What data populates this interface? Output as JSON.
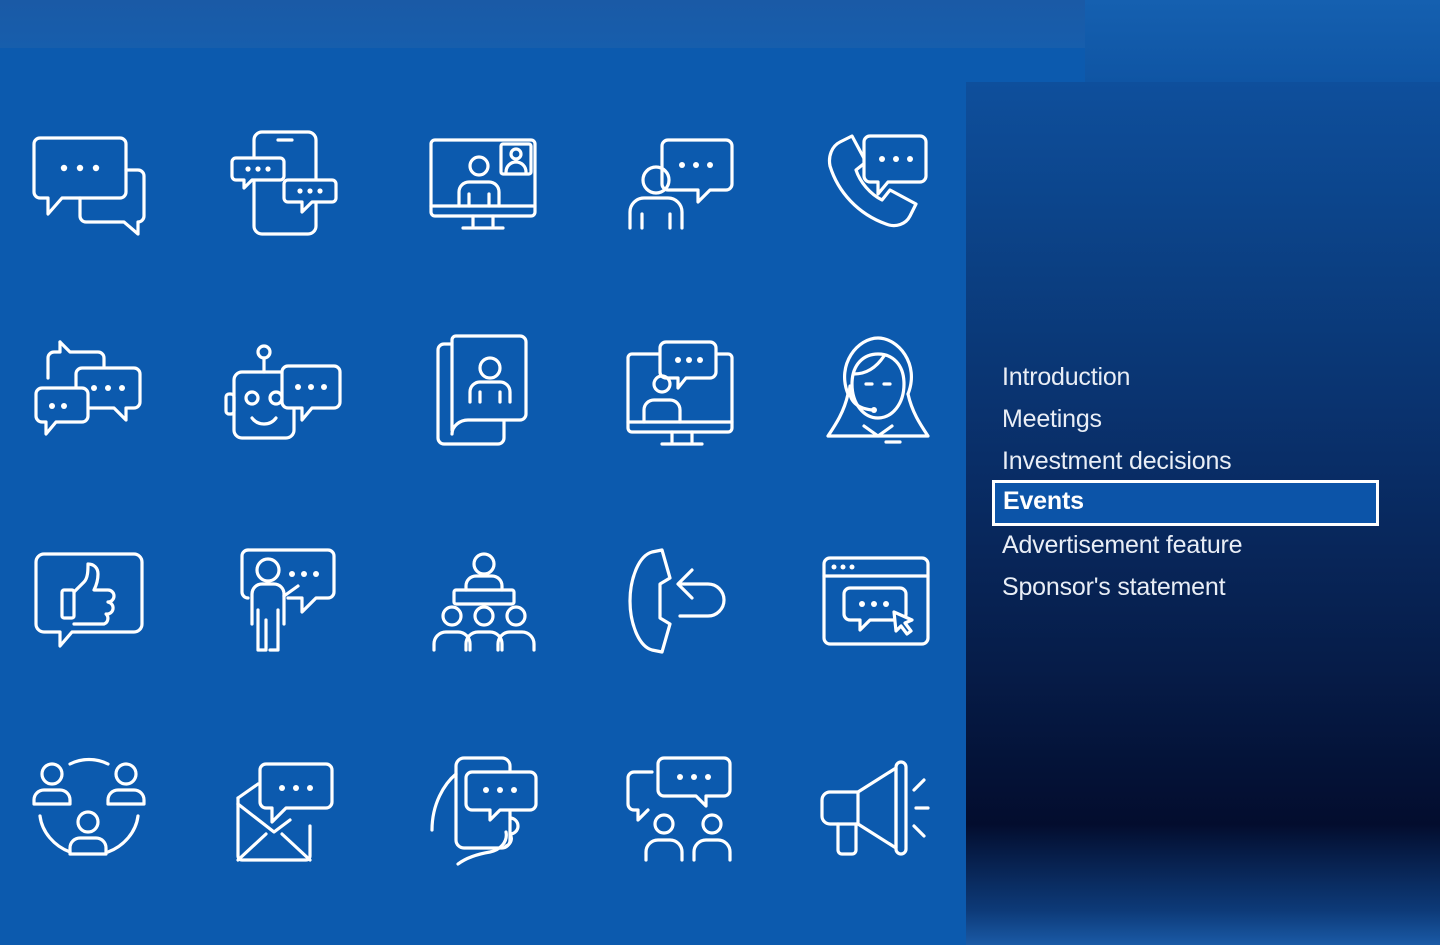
{
  "menu": {
    "items": [
      {
        "label": "Introduction",
        "active": false
      },
      {
        "label": "Meetings",
        "active": false
      },
      {
        "label": "Investment decisions",
        "active": false
      },
      {
        "label": "Events",
        "active": true
      },
      {
        "label": "Advertisement feature",
        "active": false
      },
      {
        "label": "Sponsor's statement",
        "active": false
      }
    ]
  },
  "icons": [
    "chat-bubbles-icon",
    "mobile-chat-icon",
    "video-conference-icon",
    "person-speaking-icon",
    "phone-chat-icon",
    "group-chat-icon",
    "chatbot-icon",
    "mobile-contact-icon",
    "online-presentation-icon",
    "support-agent-icon",
    "thumbs-up-chat-icon",
    "presenter-icon",
    "audience-meeting-icon",
    "callback-phone-icon",
    "web-chat-window-icon",
    "network-people-icon",
    "email-chat-icon",
    "hand-phone-chat-icon",
    "team-discussion-icon",
    "megaphone-icon"
  ],
  "colors": {
    "background": "#0c5aae",
    "active_border": "#ffffff",
    "text": "#e9eef6"
  }
}
